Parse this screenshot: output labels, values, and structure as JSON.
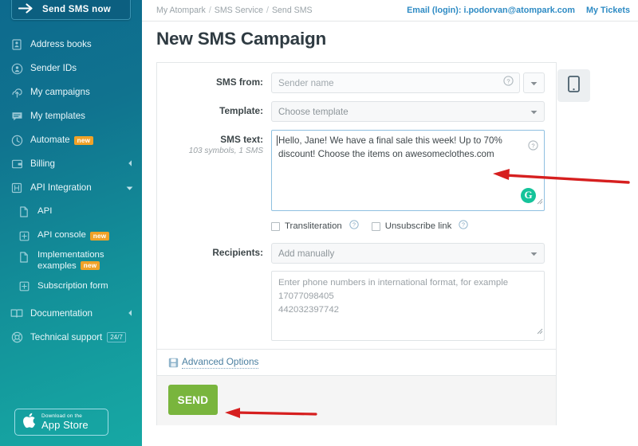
{
  "sidebar": {
    "cta": {
      "label": "Send SMS now",
      "icon": "arrow-right-icon"
    },
    "items": [
      {
        "label": "Address books",
        "icon": "address-book-icon",
        "badge": null,
        "caret": null,
        "sub": false
      },
      {
        "label": "Sender IDs",
        "icon": "sender-id-icon",
        "badge": null,
        "caret": null,
        "sub": false
      },
      {
        "label": "My campaigns",
        "icon": "campaign-upload-icon",
        "badge": null,
        "caret": null,
        "sub": false
      },
      {
        "label": "My templates",
        "icon": "chat-template-icon",
        "badge": null,
        "caret": null,
        "sub": false
      },
      {
        "label": "Automate",
        "icon": "clock-automate-icon",
        "badge": "new",
        "caret": null,
        "sub": false
      },
      {
        "label": "Billing",
        "icon": "wallet-billing-icon",
        "badge": null,
        "caret": "right",
        "sub": false
      },
      {
        "label": "API Integration",
        "icon": "api-integration-icon",
        "badge": null,
        "caret": "down",
        "sub": false
      },
      {
        "label": "API",
        "icon": "document-icon",
        "badge": null,
        "caret": null,
        "sub": true
      },
      {
        "label": "API console",
        "icon": "console-plus-icon",
        "badge": "new",
        "caret": null,
        "sub": true
      },
      {
        "label": "Implementations examples",
        "icon": "document-icon",
        "badge": "new",
        "caret": null,
        "sub": true
      },
      {
        "label": "Subscription form",
        "icon": "form-plus-icon",
        "badge": null,
        "caret": null,
        "sub": true
      },
      {
        "label": "Documentation",
        "icon": "book-icon",
        "badge": null,
        "caret": "right",
        "sub": false
      },
      {
        "label": "Technical support",
        "icon": "lifebuoy-icon",
        "badge": "24/7",
        "caret": null,
        "sub": false
      }
    ],
    "appstore": {
      "small": "Download on the",
      "big": "App Store",
      "icon": "apple-icon"
    }
  },
  "topbar": {
    "breadcrumb": [
      "My Atompark",
      "SMS Service",
      "Send SMS"
    ],
    "separator": "/",
    "email_label": "Email (login): i.podorvan@atompark.com",
    "tickets_label": "My Tickets"
  },
  "page": {
    "title": "New SMS Campaign"
  },
  "preview": {
    "icon": "mobile-phone-icon"
  },
  "form": {
    "sms_from": {
      "label": "SMS from:",
      "value": "",
      "placeholder": "Sender name",
      "help_icon": "question-mark-icon",
      "dropdown_icon": "caret-down-icon"
    },
    "template": {
      "label": "Template:",
      "value": "",
      "placeholder": "Choose template",
      "dropdown_icon": "caret-down-icon"
    },
    "sms_text": {
      "label": "SMS text:",
      "counter": "103 symbols, 1 SMS",
      "value": "Hello, Jane! We have a final sale this week! Up to 70% discount! Choose the items on awesomeclothes.com",
      "help_icon": "question-mark-icon",
      "grammarly_icon": "grammarly-icon",
      "grammarly_glyph": "G"
    },
    "transliteration": {
      "label": "Transliteration",
      "checked": false,
      "help_icon": "question-mark-icon"
    },
    "unsubscribe": {
      "label": "Unsubscribe link",
      "checked": false,
      "help_icon": "question-mark-icon"
    },
    "recipients": {
      "label": "Recipients:",
      "value": "",
      "placeholder": "Add manually",
      "dropdown_icon": "caret-down-icon"
    },
    "phones": {
      "value": "",
      "placeholder": "Enter phone numbers in international format, for example\n17077098405\n442032397742"
    },
    "advanced": {
      "label": "Advanced Options",
      "icon": "advanced-options-icon"
    },
    "send": {
      "label": "SEND"
    }
  },
  "annotations": {
    "arrow_color": "#d61f1f",
    "arrow_textarea": "arrow-pointing-to-sms-text",
    "arrow_send": "arrow-pointing-to-send-button"
  },
  "colors": {
    "sidebar_top": "#0d6a8e",
    "sidebar_bottom": "#17a8a4",
    "accent_link": "#2e8bc4",
    "send_green": "#79b53d",
    "badge_orange": "#f0a228",
    "grammarly_green": "#15c39a",
    "annotation_red": "#d61f1f"
  }
}
